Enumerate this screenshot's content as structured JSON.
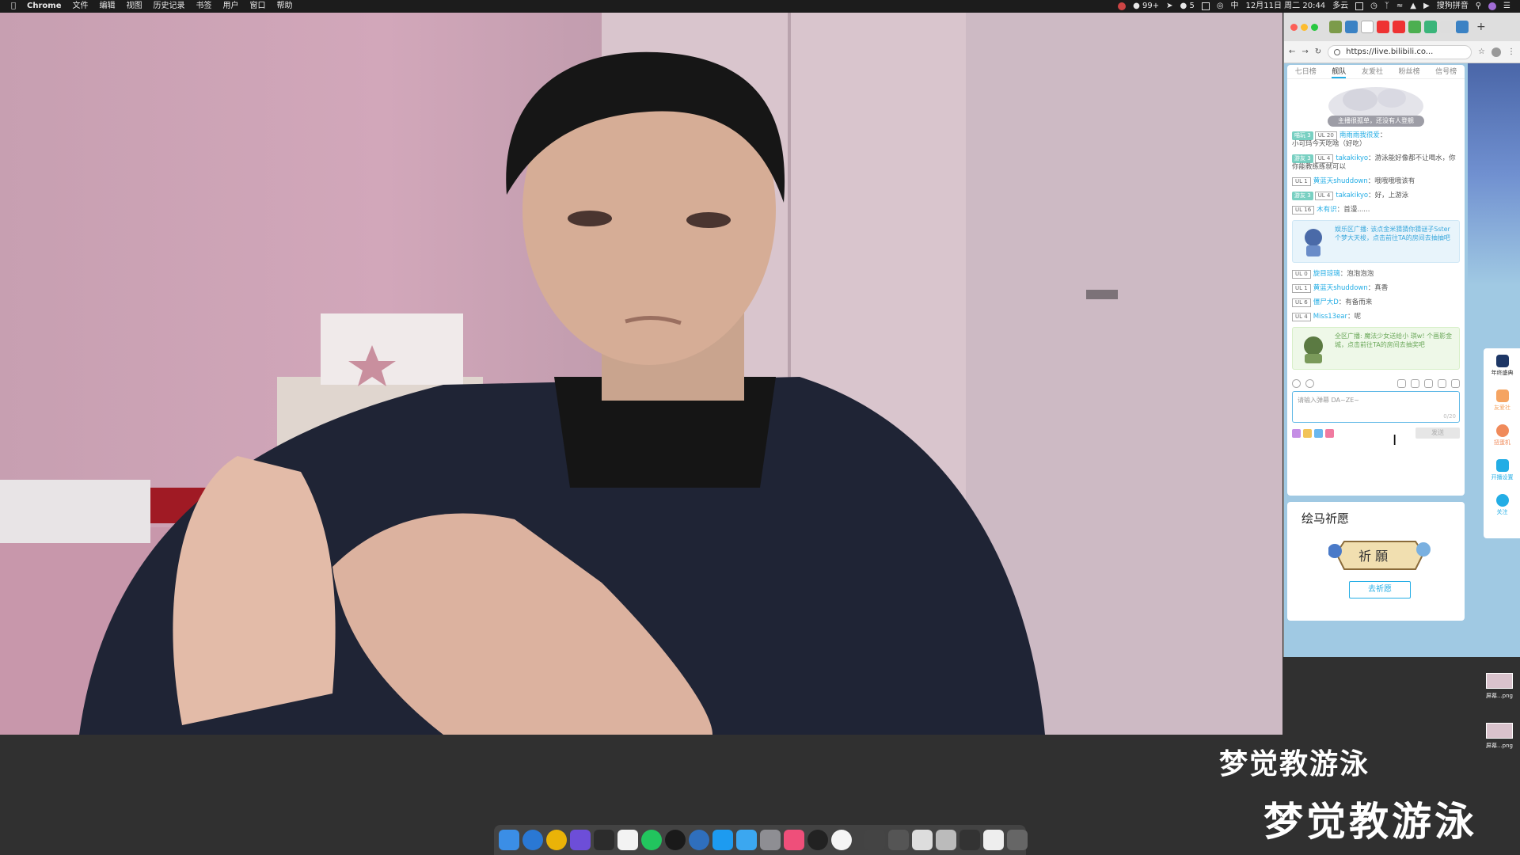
{
  "menubar": {
    "app_name": "Chrome",
    "menus": [
      "文件",
      "编辑",
      "视图",
      "历史记录",
      "书签",
      "用户",
      "窗口",
      "帮助"
    ],
    "qq_count": "99+",
    "wechat_count": "5",
    "datetime": "12月11日 周二 20:44",
    "weather": "多云",
    "input_method": "搜狗拼音"
  },
  "browser": {
    "url": "https://live.bilibili.co..."
  },
  "room": {
    "rank_tabs": [
      "七日榜",
      "舰队",
      "友爱社",
      "粉丝榜",
      "信号榜"
    ],
    "active_tab": "舰队",
    "banner_text": "主播很孤单，还没有人登舰",
    "messages": [
      {
        "medal": "喵玩 3",
        "ul": "UL 20",
        "user": "南雨雨我很爱",
        "text": "小可玛今天吃啥（好吃）"
      },
      {
        "medal": "游友 3",
        "ul": "UL 4",
        "user": "takakikyo",
        "text": "游泳能好像都不让喝水，你你能教练练就可以"
      },
      {
        "ul": "UL 1",
        "user": "黄蓝天shuddown",
        "text": "哦哦哦哦该有"
      },
      {
        "medal": "游友 3",
        "ul": "UL 4",
        "user": "takakikyo",
        "text": "好，上游泳"
      },
      {
        "ul": "UL 16",
        "user": "木有识",
        "text": "首漫......"
      }
    ],
    "broadcast1": "娱乐区广播: 该点金米猜猜你猜谜子Sster个梦大天梭，点击前往TA的房间去抽抽吧",
    "messages2": [
      {
        "ul": "UL 0",
        "user": "旋目琼璃",
        "text": "泡泡泡泡"
      },
      {
        "ul": "UL 1",
        "user": "黄蓝天shuddown",
        "text": "真香"
      },
      {
        "ul": "UL 6",
        "user": "僵尸大D",
        "text": "有备而来"
      },
      {
        "ul": "UL 4",
        "user": "Miss13ear",
        "text": "呢"
      }
    ],
    "broadcast2": "全区广播: 魔法少女送给小 琪w! 个画影金城，点击前往TA的房间去抽奖吧",
    "input_placeholder": "请输入弹幕 DA~ZE~",
    "input_count": "0/20",
    "send_label": "发送",
    "wish_title": "绘马祈愿",
    "wish_button": "去祈愿",
    "side_menu": [
      "年终盛典",
      "友爱社",
      "扭蛋机",
      "开播设置",
      "关注"
    ]
  },
  "desktop_files": [
    "屏幕...png",
    "屏幕...png"
  ],
  "captions": {
    "line1": "梦觉教游泳",
    "line2": "梦觉教游泳"
  }
}
